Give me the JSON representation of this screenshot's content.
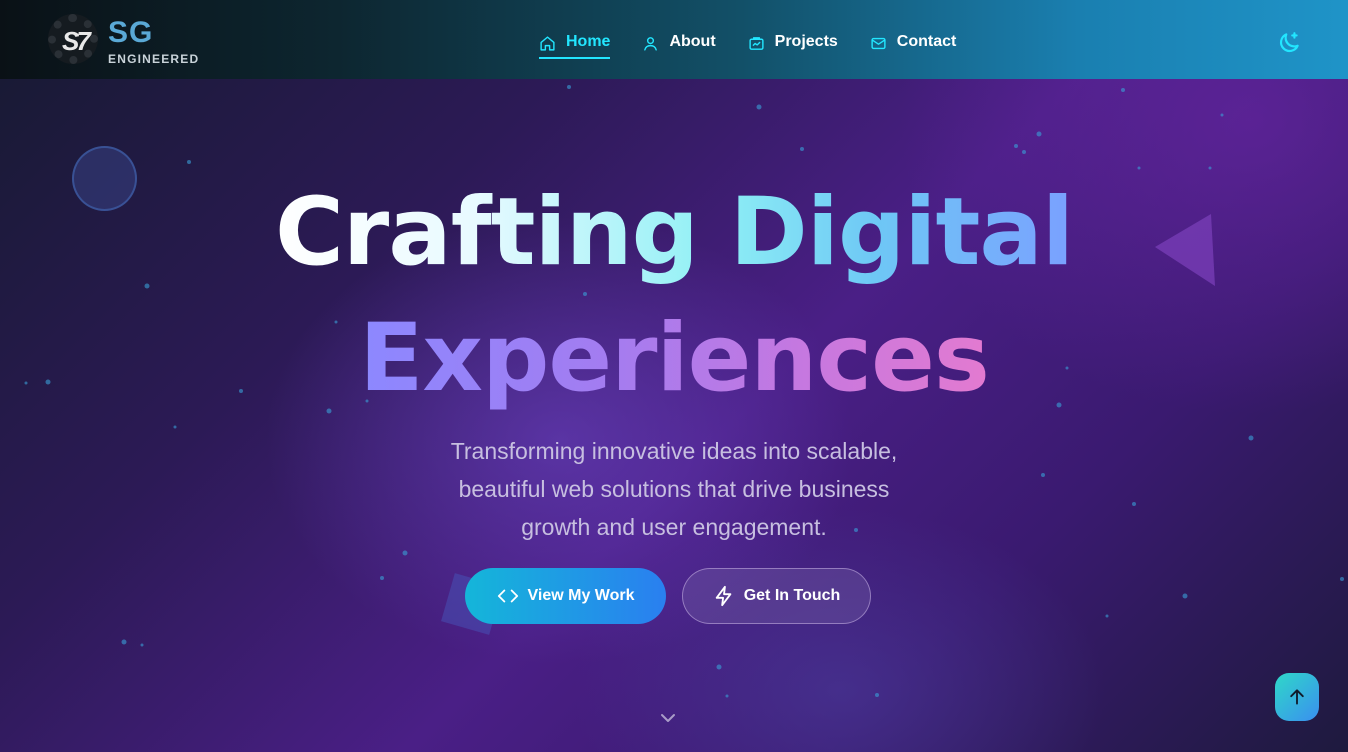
{
  "brand": {
    "mark": "S7",
    "name": "SG",
    "tagline": "ENGINEERED"
  },
  "nav": {
    "items": [
      {
        "label": "Home",
        "icon": "home-icon",
        "active": true
      },
      {
        "label": "About",
        "icon": "user-icon",
        "active": false
      },
      {
        "label": "Projects",
        "icon": "projects-icon",
        "active": false
      },
      {
        "label": "Contact",
        "icon": "mail-icon",
        "active": false
      }
    ],
    "theme_toggle_icon": "moon-icon"
  },
  "hero": {
    "title_line1": "Crafting Digital",
    "title_line2": "Experiences",
    "subtitle": "Transforming innovative ideas into scalable, beautiful web solutions that drive business growth and user engagement.",
    "primary_button": "View My Work",
    "primary_button_icon": "code-icon",
    "secondary_button": "Get In Touch",
    "secondary_button_icon": "lightning-icon"
  },
  "colors": {
    "accent": "#22e6ff",
    "primary_button_start": "#14b6d9",
    "primary_button_end": "#2a7ff0"
  }
}
